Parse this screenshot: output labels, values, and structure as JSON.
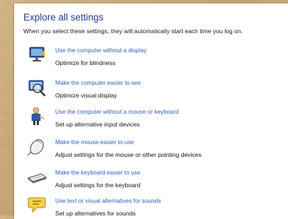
{
  "header": {
    "title": "Explore all settings",
    "description": "When you select these settings, they will automatically start each time you log on."
  },
  "items": [
    {
      "icon": "monitor-speaker-icon",
      "link": "Use the computer without a display",
      "sub": "Optimize for blindness"
    },
    {
      "icon": "magnifier-screen-icon",
      "link": "Make the computer easier to see",
      "sub": "Optimize visual display"
    },
    {
      "icon": "person-at-computer-icon",
      "link": "Use the computer without a mouse or keyboard",
      "sub": "Set up alternative input devices"
    },
    {
      "icon": "mouse-icon",
      "link": "Make the mouse easier to use",
      "sub": "Adjust settings for the mouse or other pointing devices"
    },
    {
      "icon": "keyboard-icon",
      "link": "Make the keyboard easier to use",
      "sub": "Adjust settings for the keyboard"
    },
    {
      "icon": "speech-bubble-icon",
      "link": "Use text or visual alternatives for sounds",
      "sub": "Set up alternatives for sounds"
    }
  ],
  "colors": {
    "link": "#2f5fbc",
    "title": "#1e3d8a",
    "background": "#c9ab7c"
  }
}
